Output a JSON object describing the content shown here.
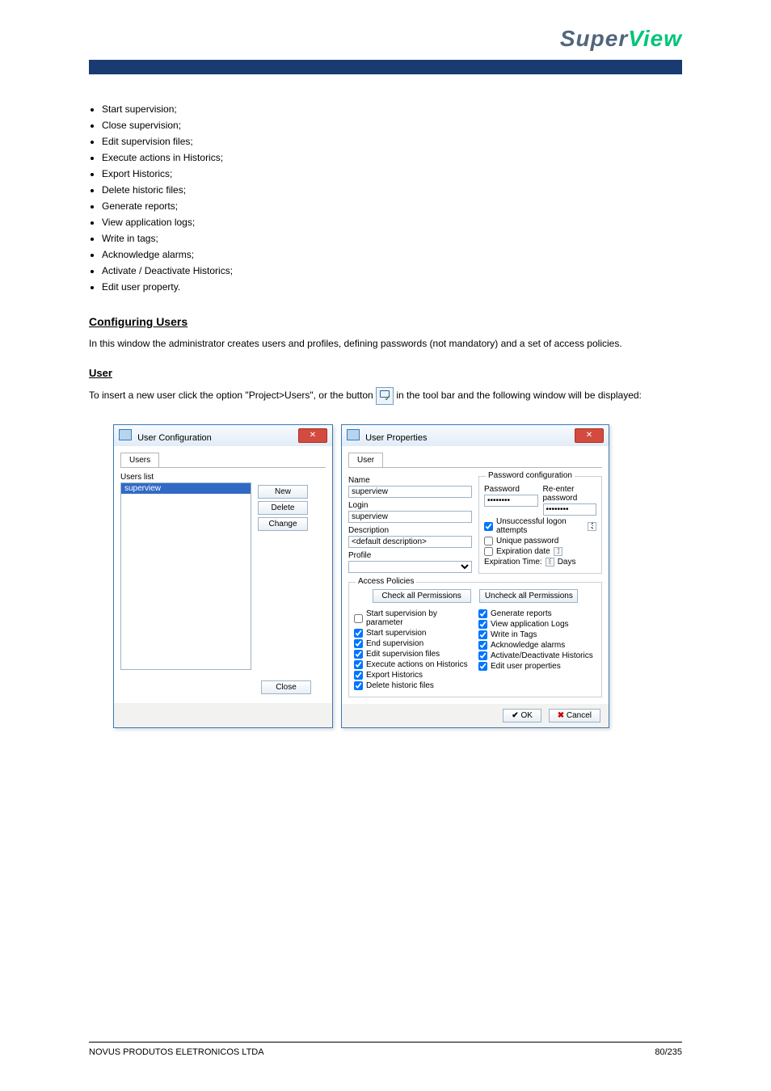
{
  "logo": {
    "pre": "Super",
    "post": "View"
  },
  "bullets": [
    "Start supervision;",
    "Close supervision;",
    "Edit supervision files;",
    "Execute actions in Historics;",
    "Export Historics;",
    "Delete historic files;",
    "Generate reports;",
    "View application logs;",
    "Write in tags;",
    "Acknowledge alarms;",
    "Activate / Deactivate Historics;",
    "Edit user property."
  ],
  "section_title": "Configuring Users",
  "p1": "In this window the administrator creates users and profiles, defining passwords (not mandatory) and a set of access policies.",
  "sub_head": "User",
  "p2_a": "To insert a new user click the option \"Project>Users\", or the button ",
  "p2_b": " in the tool bar and the following window will be displayed:",
  "cfg": {
    "title": "User Configuration",
    "tab": "Users",
    "list_label": "Users list",
    "selected": "superview",
    "btn_new": "New",
    "btn_delete": "Delete",
    "btn_change": "Change",
    "btn_close": "Close"
  },
  "props": {
    "title": "User Properties",
    "tab": "User",
    "name_label": "Name",
    "name": "superview",
    "login_label": "Login",
    "login": "superview",
    "desc_label": "Description",
    "desc": "<default description>",
    "profile_label": "Profile",
    "pwd_group": "Password configuration",
    "pwd_label": "Password",
    "pwd_val": "********",
    "repwd_label": "Re-enter password",
    "repwd_val": "********",
    "unsuccessful": "Unsuccessful logon attempts",
    "unsuccessful_val": "3",
    "unique_pwd": "Unique password",
    "exp_date": "Expiration date",
    "exp_date_val": "18/05/2012",
    "exp_time": "Expiration Time:",
    "exp_time_val": "80",
    "days": "Days",
    "policies_group": "Access Policies",
    "check_all": "Check all Permissions",
    "uncheck_all": "Uncheck all Permissions",
    "left": [
      {
        "label": "Start supervision by parameter",
        "checked": false
      },
      {
        "label": "Start supervision",
        "checked": true
      },
      {
        "label": "End supervision",
        "checked": true
      },
      {
        "label": "Edit supervision files",
        "checked": true
      },
      {
        "label": "Execute actions on Historics",
        "checked": true
      },
      {
        "label": "Export Historics",
        "checked": true
      },
      {
        "label": "Delete historic files",
        "checked": true
      }
    ],
    "right": [
      {
        "label": "Generate reports",
        "checked": true
      },
      {
        "label": "View application Logs",
        "checked": true
      },
      {
        "label": "Write in Tags",
        "checked": true
      },
      {
        "label": "Acknowledge alarms",
        "checked": true
      },
      {
        "label": "Activate/Deactivate Historics",
        "checked": true
      },
      {
        "label": "Edit user properties",
        "checked": true
      }
    ],
    "ok": "OK",
    "cancel": "Cancel"
  },
  "footer": {
    "left": "NOVUS PRODUTOS ELETRONICOS LTDA",
    "right": "80/235"
  }
}
